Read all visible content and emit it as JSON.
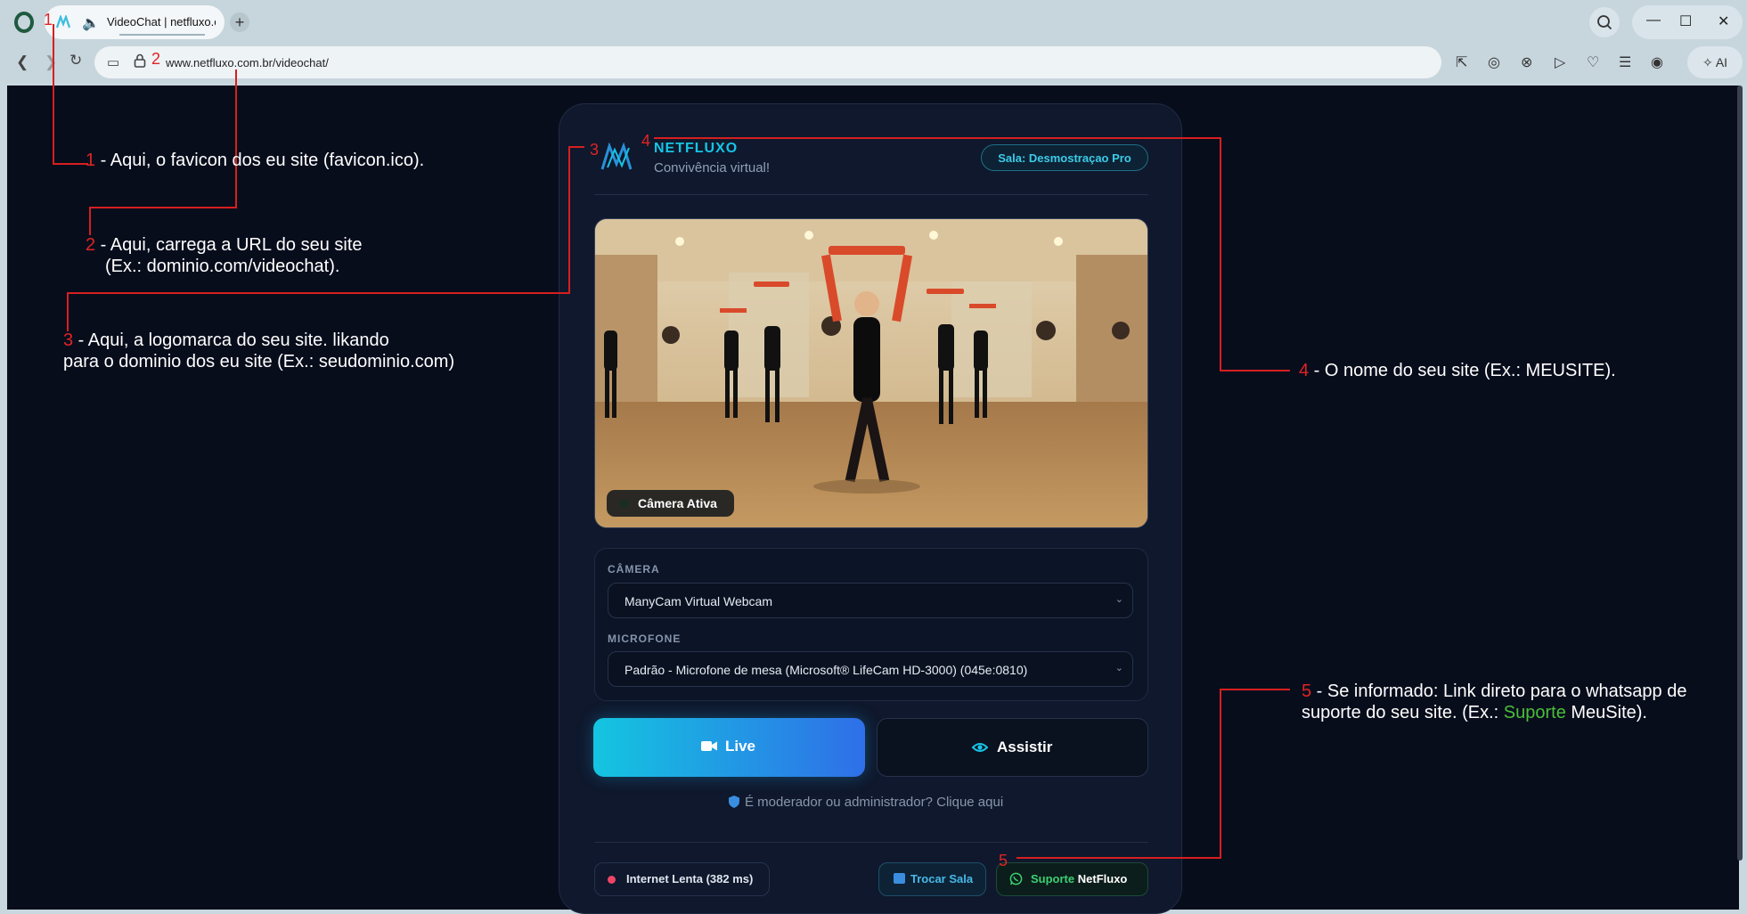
{
  "browser": {
    "tab_title": "VideoChat | netfluxo.c",
    "url": "www.netfluxo.com.br/videochat/",
    "ai_label": "AI"
  },
  "page": {
    "brand_name": "NETFLUXO",
    "brand_tagline": "Convivência virtual!",
    "room_badge": "Sala: Desmostraçao Pro",
    "camera_status": "Câmera Ativa",
    "camera_label": "CÂMERA",
    "camera_value": "ManyCam Virtual Webcam",
    "mic_label": "MICROFONE",
    "mic_value": "Padrão - Microfone de mesa (Microsoft® LifeCam HD-3000) (045e:0810)",
    "live_button": "Live",
    "watch_button": "Assistir",
    "moderator_link": "É moderador ou administrador? Clique aqui",
    "network_status": "Internet Lenta (382 ms)",
    "swap_room_button": "Trocar Sala",
    "support_button_prefix": "Suporte",
    "support_button_brand": "NetFluxo"
  },
  "annotations": {
    "a1_num": "1",
    "a1_text": " - Aqui, o favicon dos eu site (favicon.ico).",
    "a2_num": "2",
    "a2_line1": " - Aqui, carrega a URL do seu site",
    "a2_line2": "(Ex.: dominio.com/videochat).",
    "a3_num": "3",
    "a3_line1": " - Aqui, a logomarca do seu site. likando",
    "a3_line2": "para o dominio dos eu site (Ex.: seudominio.com)",
    "a4_num": "4",
    "a4_text": " - O nome do seu site (Ex.: MEUSITE).",
    "a5_num": "5",
    "a5_line1": " - Se informado: Link direto para o whatsapp de",
    "a5_line2_pre": "suporte do seu site. (Ex.: ",
    "a5_line2_green": "Suporte",
    "a5_line2_post": " MeuSite)."
  },
  "colors": {
    "accent_cyan": "#16c4e6",
    "live_gradient_start": "#14c5e0",
    "live_gradient_end": "#2f6fe8",
    "annotation_red": "#e02424",
    "support_green": "#3ccf72",
    "page_background": "#080d1c"
  },
  "icons": {
    "opera": "opera-logo-icon",
    "speaker": "speaker-icon",
    "new_tab": "plus-icon",
    "search": "search-icon",
    "back": "back-arrow-icon",
    "forward": "forward-arrow-icon",
    "reload": "reload-icon",
    "lock": "lock-icon",
    "camera": "video-camera-icon",
    "eye": "eye-icon",
    "shield": "shield-icon",
    "whatsapp": "whatsapp-icon"
  }
}
